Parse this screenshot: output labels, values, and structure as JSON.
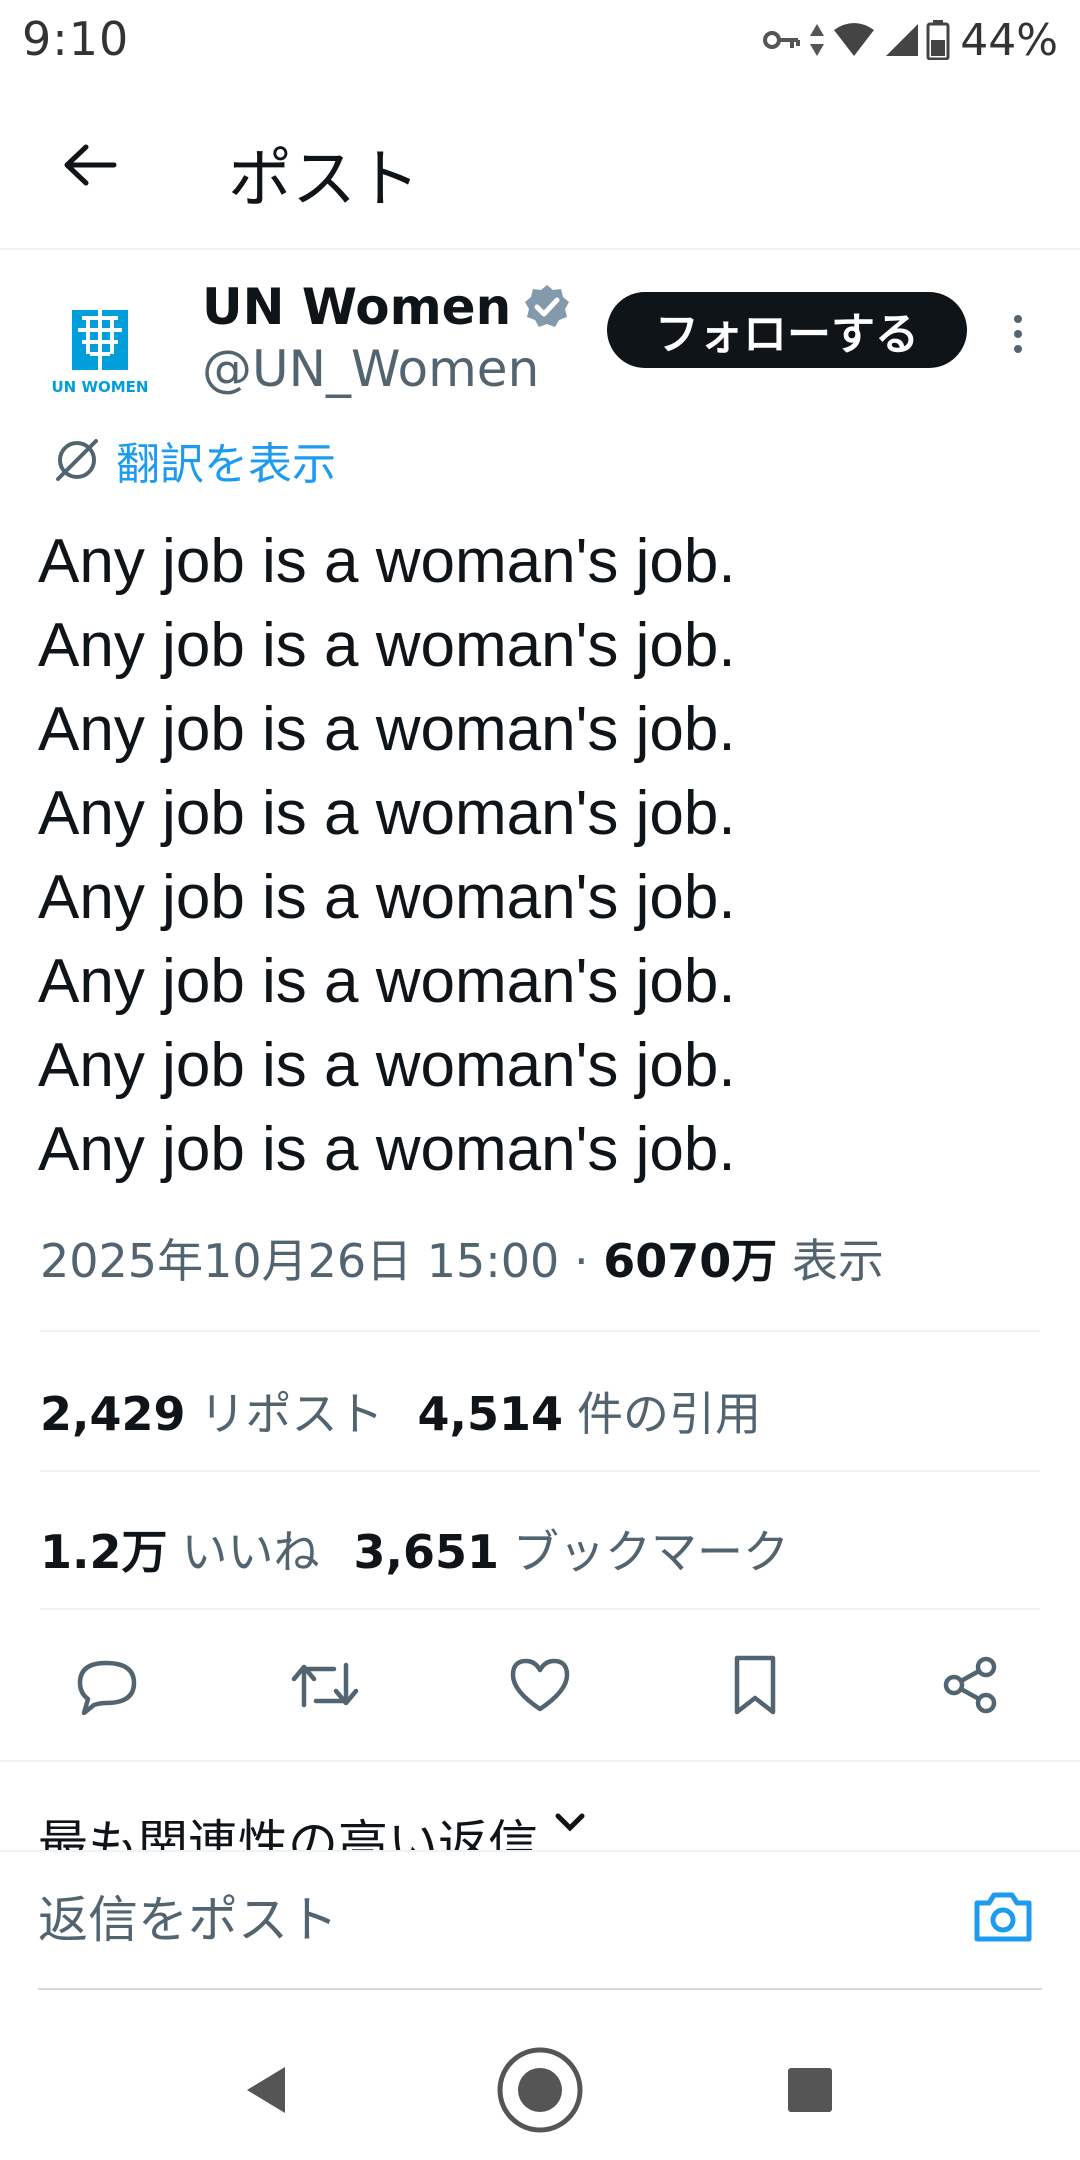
{
  "status_bar": {
    "time": "9:10",
    "battery": "44%",
    "icons": [
      "vpn-key-icon",
      "data-arrows-icon",
      "wifi-icon",
      "signal-icon",
      "battery-icon"
    ]
  },
  "header": {
    "title": "ポスト",
    "back_icon": "arrow-left-icon"
  },
  "author": {
    "name": "UN Women",
    "handle": "@UN_Women",
    "verified": true,
    "verified_color": "#829aab",
    "avatar_label": "UN WOMEN",
    "follow_label": "フォローする"
  },
  "translate": {
    "label": "翻訳を表示",
    "color": "#1d9bf0"
  },
  "tweet": {
    "lines": [
      "Any job is a woman's job.",
      "Any job is a woman's job.",
      "Any job is a woman's job.",
      "Any job is a woman's job.",
      "Any job is a woman's job.",
      "Any job is a woman's job.",
      "Any job is a woman's job.",
      "Any job is a woman's job."
    ],
    "timestamp": "2025年10月26日 15:00",
    "separator": "·",
    "views_count": "6070万",
    "views_label": "表示"
  },
  "stats": {
    "reposts_count": "2,429",
    "reposts_label": "リポスト",
    "quotes_count": "4,514",
    "quotes_label": "件の引用",
    "likes_count": "1.2万",
    "likes_label": "いいね",
    "bookmarks_count": "3,651",
    "bookmarks_label": "ブックマーク"
  },
  "actions": [
    "reply-icon",
    "repost-icon",
    "like-icon",
    "bookmark-icon",
    "share-icon"
  ],
  "replies": {
    "sort_label": "最も関連性の高い返信",
    "reply_placeholder": "返信をポスト",
    "accent": "#1d9bf0"
  },
  "nav": [
    "back-triangle-icon",
    "home-circle-icon",
    "recents-square-icon"
  ]
}
